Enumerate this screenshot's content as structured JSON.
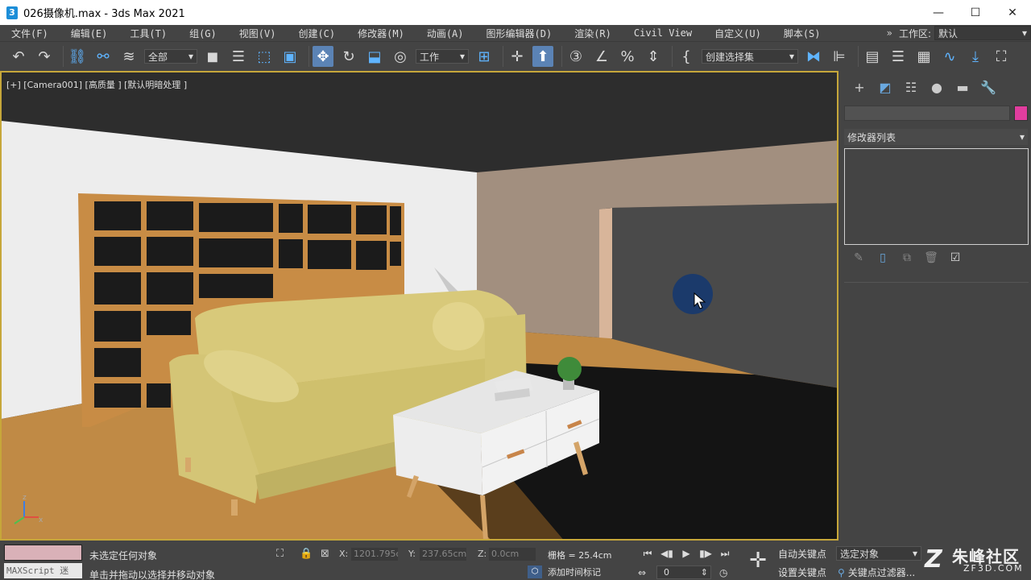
{
  "window": {
    "title": "026摄像机.max - 3ds Max 2021",
    "app_icon_text": "3",
    "min_glyph": "—",
    "max_glyph": "☐",
    "close_glyph": "✕"
  },
  "menu": {
    "items": [
      "文件(F)",
      "编辑(E)",
      "工具(T)",
      "组(G)",
      "视图(V)",
      "创建(C)",
      "修改器(M)",
      "动画(A)",
      "图形编辑器(D)",
      "渲染(R)",
      "Civil View",
      "自定义(U)",
      "脚本(S)"
    ],
    "workspace_label": "工作区:",
    "workspace_value": "默认",
    "overflow_glyph": "»"
  },
  "toolbar": {
    "selection_filter": "全部",
    "ref_coord": "工作",
    "named_selection": "创建选择集",
    "icons": [
      "undo-icon",
      "redo-icon",
      "link-icon",
      "unlink-icon",
      "bind-space-warp-icon",
      "select-icon",
      "select-by-name-icon",
      "rect-region-icon",
      "window-crossing-icon",
      "move-icon",
      "rotate-icon",
      "scale-icon",
      "place-icon",
      "pivot-icon",
      "snap-toggle-icon",
      "angle-snap-icon",
      "percent-snap-icon",
      "spinner-snap-icon",
      "edit-named-sets-icon",
      "mirror-icon",
      "align-icon",
      "toggle-scene-explorer-icon",
      "layer-explorer-icon",
      "ribbon-icon",
      "curve-editor-icon",
      "schematic-view-icon",
      "material-editor-icon",
      "render-setup-icon"
    ]
  },
  "viewport": {
    "label": "[+] [Camera001] [高质量 ] [默认明暗处理 ]",
    "colors": {
      "ceiling": "#2f2f2f",
      "left_wall": "#ededed",
      "back_wall": "#a28f7f",
      "dark_wall": "#4a4a4a",
      "floor": "#c08a45",
      "shelf": "#c88c45",
      "sofa": "#d8c97a",
      "table": "#e6e6e6"
    },
    "axis_labels": {
      "z": "z",
      "x": "x"
    }
  },
  "command_panel": {
    "tabs": [
      "create-tab",
      "modify-tab",
      "hierarchy-tab",
      "motion-tab",
      "display-tab",
      "utilities-tab"
    ],
    "tab_glyphs": [
      "+",
      "◩",
      "☷",
      "●",
      "▬",
      "🔧"
    ],
    "modifier_list_label": "修改器列表",
    "object_color": "#e13d9e"
  },
  "status": {
    "maxscript": "MAXScript 迷",
    "message1": "未选定任何对象",
    "message2": "单击并拖动以选择并移动对象",
    "x_label": "X:",
    "x_value": "1201.795c",
    "y_label": "Y:",
    "y_value": "237.65cm",
    "z_label": "Z:",
    "z_value": "0.0cm",
    "grid": "栅格 = 25.4cm",
    "add_time_tag": "添加时间标记",
    "frame": "0",
    "auto_key": "自动关键点",
    "set_key": "设置关键点",
    "selected_set": "选定对象",
    "key_filters": "关键点过滤器...",
    "watermark_main": "朱峰社区",
    "watermark_sub": "ZF3D.COM",
    "watermark_logo": "Z"
  }
}
